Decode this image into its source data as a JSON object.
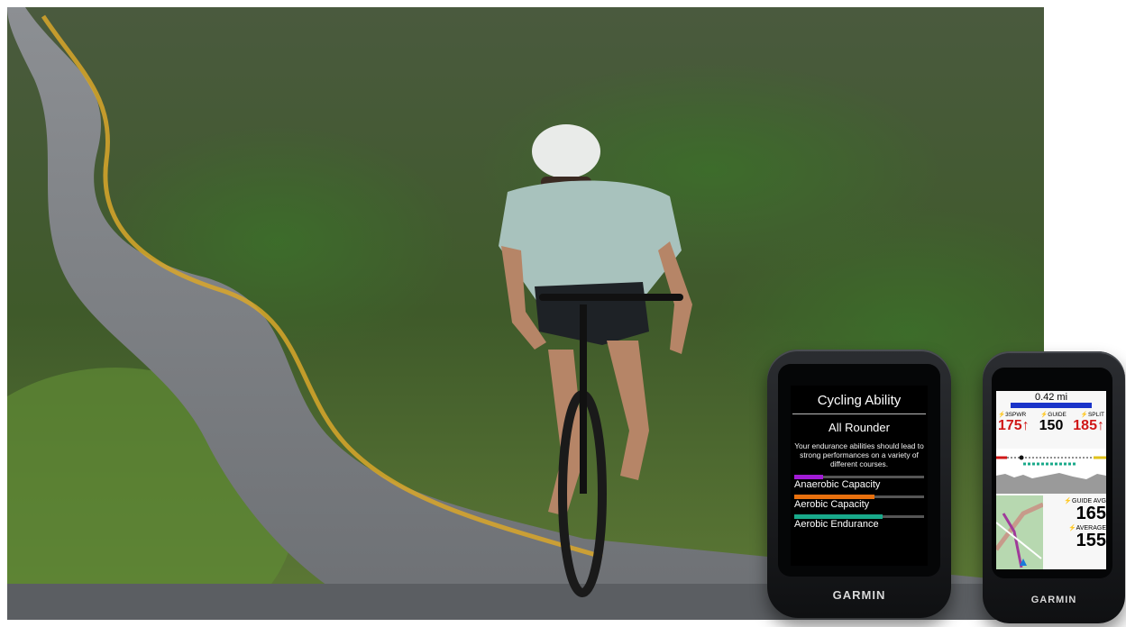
{
  "device_left": {
    "title": "Cycling Ability",
    "profile": "All Rounder",
    "description": "Your endurance abilities should lead to strong performances on a variety of different courses.",
    "metrics": [
      {
        "label": "Anaerobic Capacity",
        "level": 0.22,
        "color": "#a21bd6"
      },
      {
        "label": "Aerobic Capacity",
        "level": 0.62,
        "color": "#e8700e"
      },
      {
        "label": "Aerobic Endurance",
        "level": 0.68,
        "color": "#19a98a"
      }
    ],
    "brand": "GARMIN"
  },
  "device_right": {
    "distance": "0.42 mi",
    "labels": [
      "3SPWR",
      "GUIDE",
      "SPLIT"
    ],
    "values": [
      "175↑",
      "150",
      "185↑"
    ],
    "guide_avg_label": "GUIDE AVG",
    "guide_avg_value": "165",
    "average_label": "AVERAGE",
    "average_value": "155",
    "brand": "GARMIN"
  },
  "colors": {
    "red": "#d01818",
    "blue": "#1a34c9"
  }
}
